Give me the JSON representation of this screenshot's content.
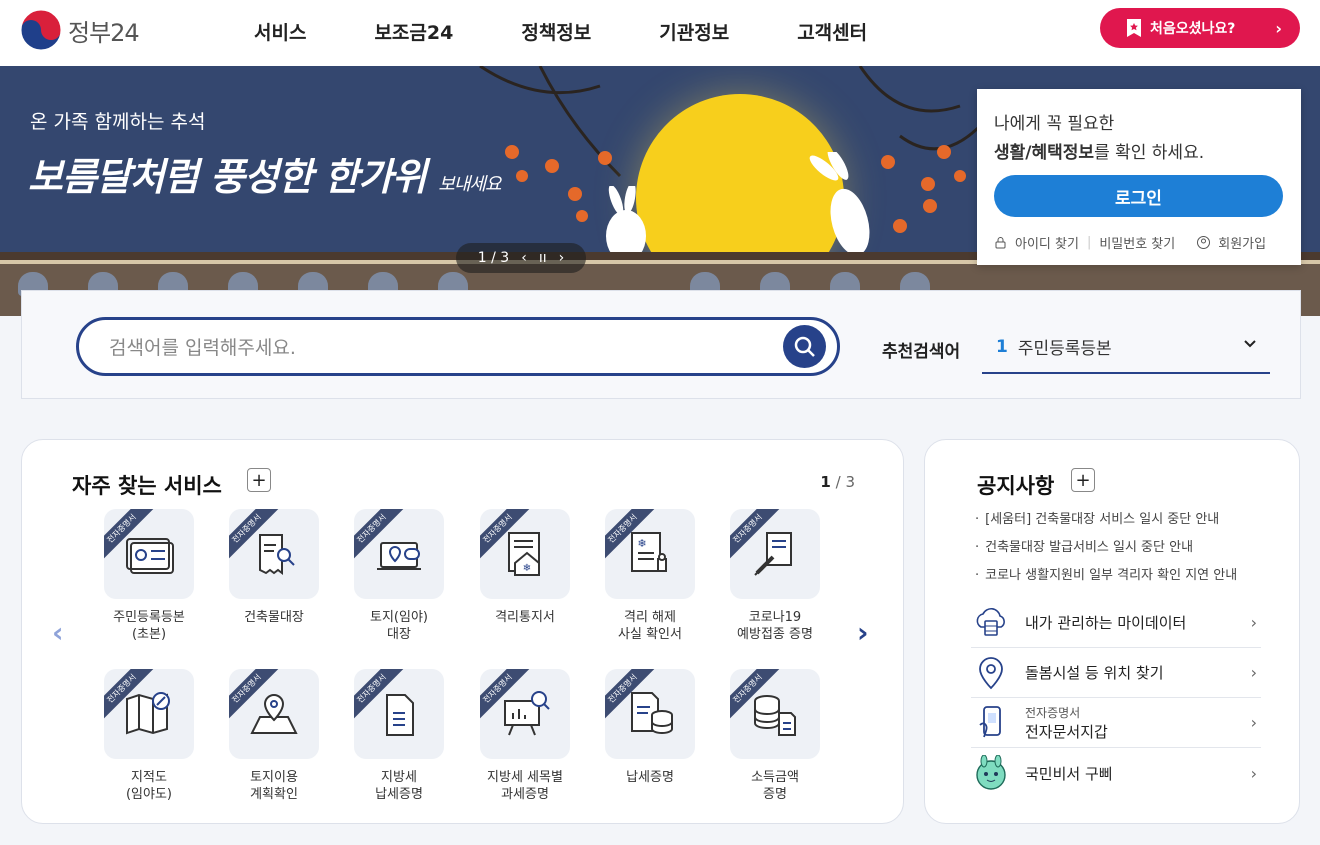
{
  "header": {
    "logo_text": "정부24",
    "nav": [
      "서비스",
      "보조금24",
      "정책정보",
      "기관정보",
      "고객센터"
    ],
    "first_visit_label": "처음오셨나요?",
    "first_visit_arrow": "›"
  },
  "banner": {
    "subtitle": "온 가족 함께하는 추석",
    "title_main": "보름달처럼 풍성한 한가위",
    "title_tail": "보내세요",
    "pager": {
      "current": "1 / 3",
      "prev": "‹",
      "pause": "ıı",
      "next": "›"
    }
  },
  "login": {
    "line1": "나에게 꼭 필요한",
    "line2_bold": "생활/혜택정보",
    "line2_rest": "를 확인 하세요.",
    "button": "로그인",
    "links": [
      "아이디 찾기",
      "비밀번호 찾기",
      "회원가입"
    ],
    "link_separator": "|"
  },
  "search": {
    "placeholder": "검색어를 입력해주세요.",
    "recommend_label": "추천검색어",
    "recommend_rank": "1",
    "recommend_value": "주민등록등본"
  },
  "services": {
    "title": "자주 찾는 서비스",
    "plus": "+",
    "page_current": "1",
    "page_sep": "/",
    "page_total": "3",
    "ribbon": "전자증명서",
    "prev_arrow": "‹",
    "next_arrow": "›",
    "items": [
      {
        "label": "주민등록등본\n(초본)",
        "icon": "id-card-icon"
      },
      {
        "label": "건축물대장",
        "icon": "document-search-icon"
      },
      {
        "label": "토지(임야)\n대장",
        "icon": "laptop-location-icon"
      },
      {
        "label": "격리통지서",
        "icon": "house-document-icon"
      },
      {
        "label": "격리 해제\n사실 확인서",
        "icon": "document-stamp-icon"
      },
      {
        "label": "코로나19\n예방접종 증명",
        "icon": "syringe-document-icon"
      },
      {
        "label": "지적도\n(임야도)",
        "icon": "map-compass-icon"
      },
      {
        "label": "토지이용\n계획확인",
        "icon": "map-pin-icon"
      },
      {
        "label": "지방세\n납세증명",
        "icon": "file-icon"
      },
      {
        "label": "지방세 세목별\n과세증명",
        "icon": "chart-board-icon"
      },
      {
        "label": "납세증명",
        "icon": "coins-document-icon"
      },
      {
        "label": "소득금액\n증명",
        "icon": "coins-file-icon"
      }
    ]
  },
  "notice": {
    "title": "공지사항",
    "plus": "+",
    "items": [
      "[세움터] 건축물대장 서비스 일시 중단 안내",
      "건축물대장 발급서비스 일시 중단 안내",
      "코로나 생활지원비 일부 격리자 확인 지연 안내"
    ],
    "quick": [
      {
        "small": "",
        "label": "내가 관리하는 마이데이터",
        "icon": "cloud-data-icon"
      },
      {
        "small": "",
        "label": "돌봄시설 등 위치 찾기",
        "icon": "location-pin-icon"
      },
      {
        "small": "전자증명서",
        "label": "전자문서지갑",
        "icon": "phone-wallet-icon"
      },
      {
        "small": "",
        "label": "국민비서 구삐",
        "icon": "robot-mascot-icon"
      }
    ],
    "arrow": "›"
  },
  "colors": {
    "brand_navy": "#27428a",
    "brand_red": "#e0174e",
    "login_blue": "#1e7fd6",
    "banner_bg": "#34476f",
    "moon": "#f7cf1c"
  }
}
